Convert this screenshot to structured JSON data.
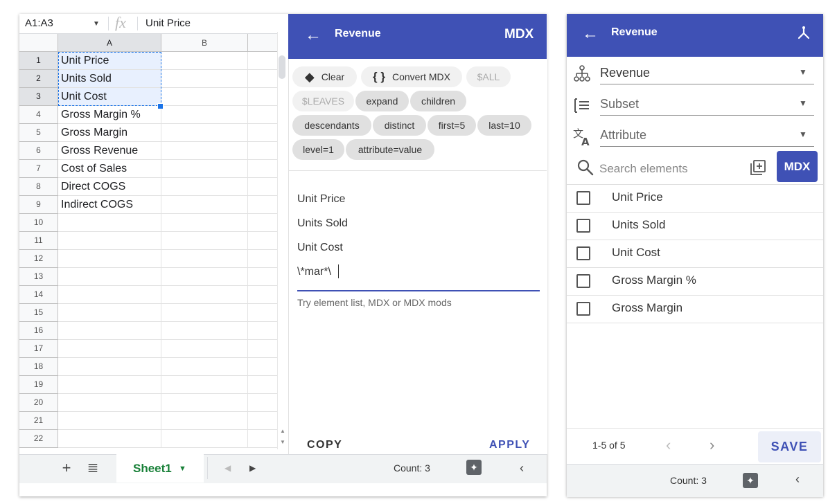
{
  "spreadsheet": {
    "name_box": "A1:A3",
    "fx_symbol": "fx",
    "formula_value": "Unit Price",
    "columns": [
      "A",
      "B"
    ],
    "rows": [
      {
        "num": "1",
        "a": "Unit Price"
      },
      {
        "num": "2",
        "a": "Units Sold"
      },
      {
        "num": "3",
        "a": "Unit Cost"
      },
      {
        "num": "4",
        "a": "Gross Margin %"
      },
      {
        "num": "5",
        "a": "Gross Margin"
      },
      {
        "num": "6",
        "a": "Gross Revenue"
      },
      {
        "num": "7",
        "a": "Cost of Sales"
      },
      {
        "num": "8",
        "a": "Direct COGS"
      },
      {
        "num": "9",
        "a": "Indirect COGS"
      },
      {
        "num": "10",
        "a": ""
      },
      {
        "num": "11",
        "a": ""
      },
      {
        "num": "12",
        "a": ""
      },
      {
        "num": "13",
        "a": ""
      },
      {
        "num": "14",
        "a": ""
      },
      {
        "num": "15",
        "a": ""
      },
      {
        "num": "16",
        "a": ""
      },
      {
        "num": "17",
        "a": ""
      },
      {
        "num": "18",
        "a": ""
      },
      {
        "num": "19",
        "a": ""
      },
      {
        "num": "20",
        "a": ""
      },
      {
        "num": "21",
        "a": ""
      },
      {
        "num": "22",
        "a": ""
      }
    ],
    "sheet_tab": "Sheet1",
    "status": "Count: 3"
  },
  "mdx_editor": {
    "title": "Revenue",
    "badge": "MDX",
    "chips": [
      {
        "label": "Clear",
        "icon": "eraser-icon"
      },
      {
        "label": "Convert MDX",
        "icon": "braces-icon"
      },
      {
        "label": "$ALL"
      },
      {
        "label": "$LEAVES"
      },
      {
        "label": "expand"
      },
      {
        "label": "children"
      },
      {
        "label": "descendants"
      },
      {
        "label": "distinct"
      },
      {
        "label": "first=5"
      },
      {
        "label": "last=10"
      },
      {
        "label": "level=1"
      },
      {
        "label": "attribute=value"
      }
    ],
    "lines": [
      "Unit Price",
      "Units Sold",
      "Unit Cost",
      "\\*mar*\\"
    ],
    "hint": "Try element list, MDX or MDX mods",
    "copy_label": "COPY",
    "apply_label": "APPLY"
  },
  "subset_panel": {
    "title": "Revenue",
    "dimension": "Revenue",
    "subset_placeholder": "Subset",
    "attribute_placeholder": "Attribute",
    "search_placeholder": "Search elements",
    "mdx_button": "MDX",
    "elements": [
      "Unit Price",
      "Units Sold",
      "Unit Cost",
      "Gross Margin %",
      "Gross Margin"
    ],
    "pager": "1-5 of 5",
    "save_label": "SAVE",
    "status": "Count: 3"
  },
  "colors": {
    "header": "#3f51b5",
    "sheet_tab": "#188038",
    "selection": "#1a73e8"
  }
}
